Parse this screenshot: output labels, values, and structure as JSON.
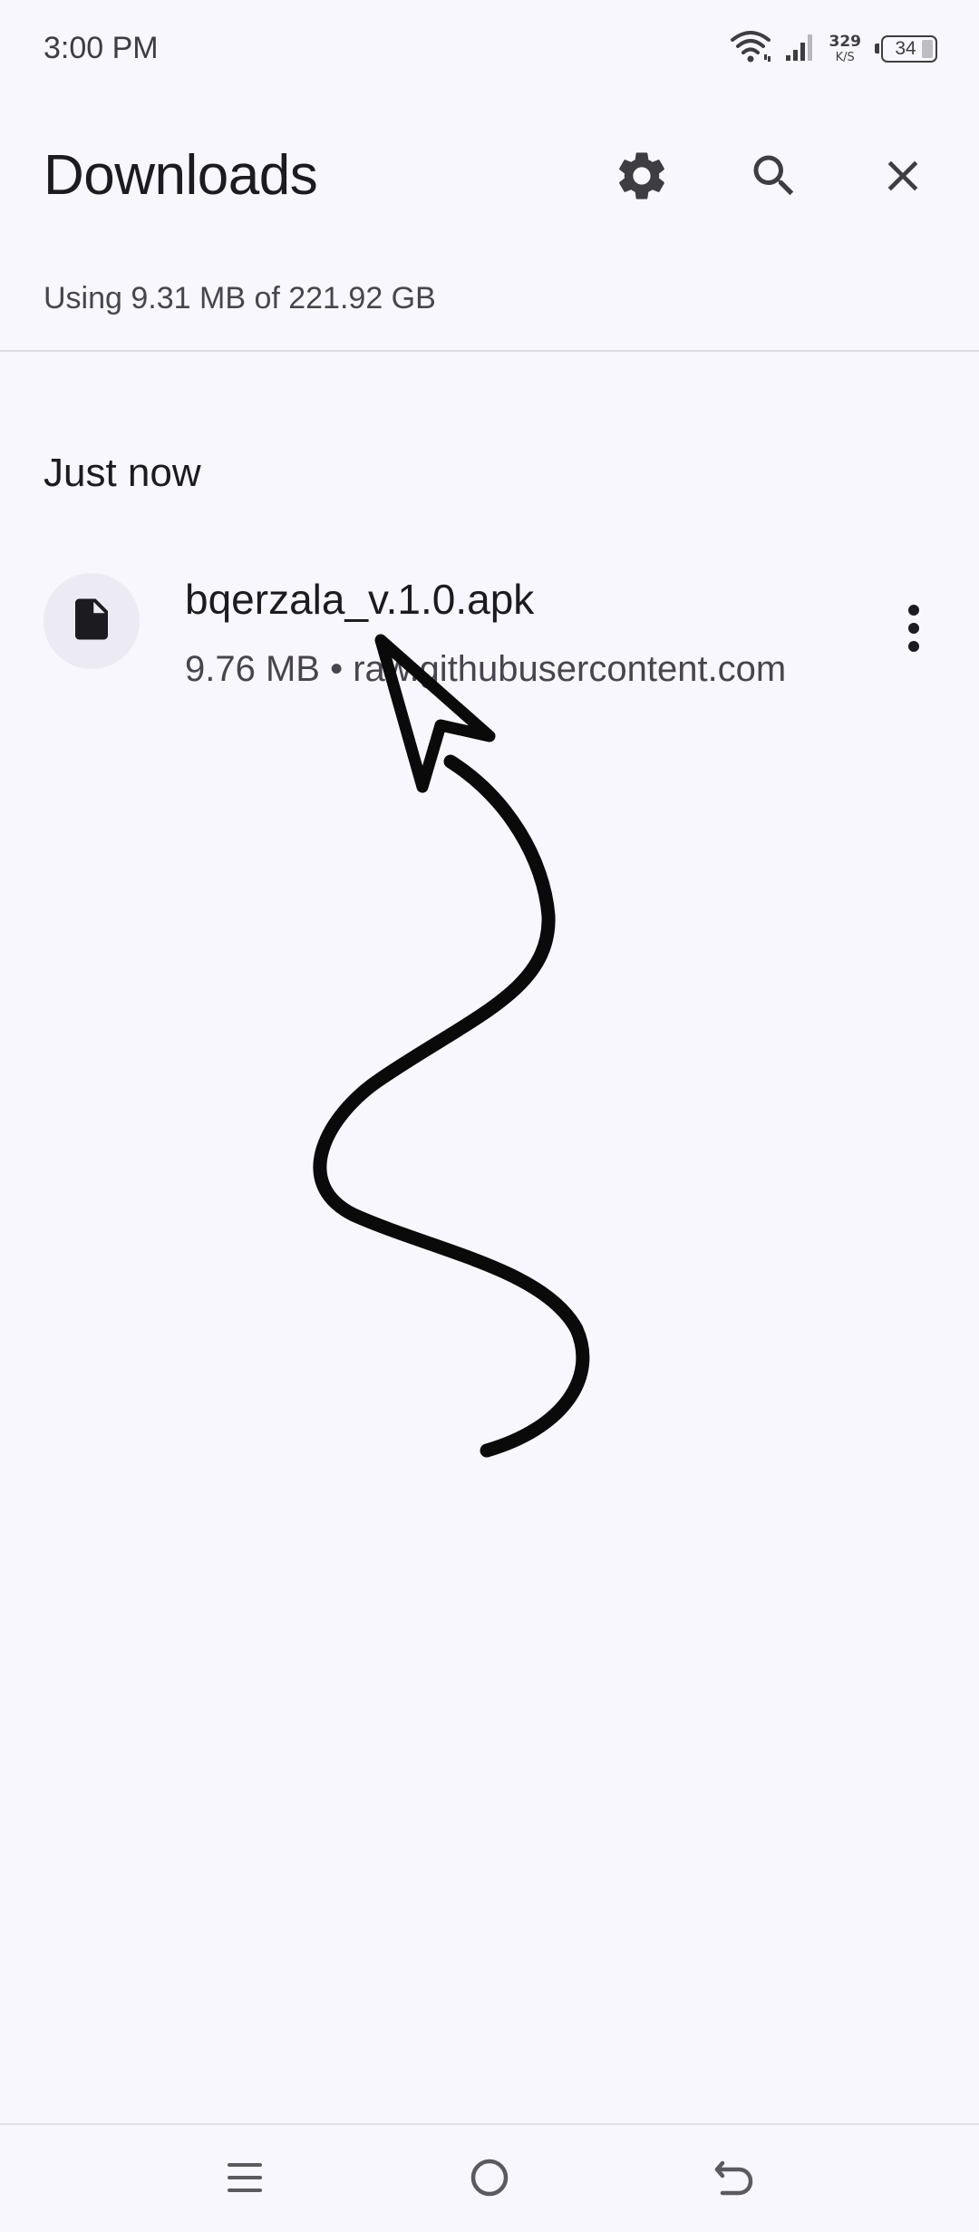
{
  "status_bar": {
    "time": "3:00 PM",
    "net_speed_value": "329",
    "net_speed_unit": "K/S",
    "battery_level": "34",
    "icons": [
      "wifi-icon",
      "signal-icon",
      "battery-icon"
    ]
  },
  "header": {
    "title": "Downloads",
    "actions": [
      "settings-icon",
      "search-icon",
      "close-icon"
    ]
  },
  "storage": {
    "text": "Using 9.31 MB of 221.92 GB"
  },
  "sections": [
    {
      "header": "Just now",
      "items": [
        {
          "icon": "file-icon",
          "name": "bqerzala_v.1.0.apk",
          "meta": "9.76 MB • raw.githubusercontent.com",
          "menu_icon": "more-vert-icon"
        }
      ]
    }
  ],
  "nav_bar": {
    "buttons": [
      "menu-icon",
      "home-icon",
      "back-icon"
    ]
  },
  "colors": {
    "background": "#f8f7fd",
    "text_primary": "#1c1b1f",
    "text_secondary": "#49454f",
    "icon": "#3d3d42",
    "annotation": "#000000"
  }
}
